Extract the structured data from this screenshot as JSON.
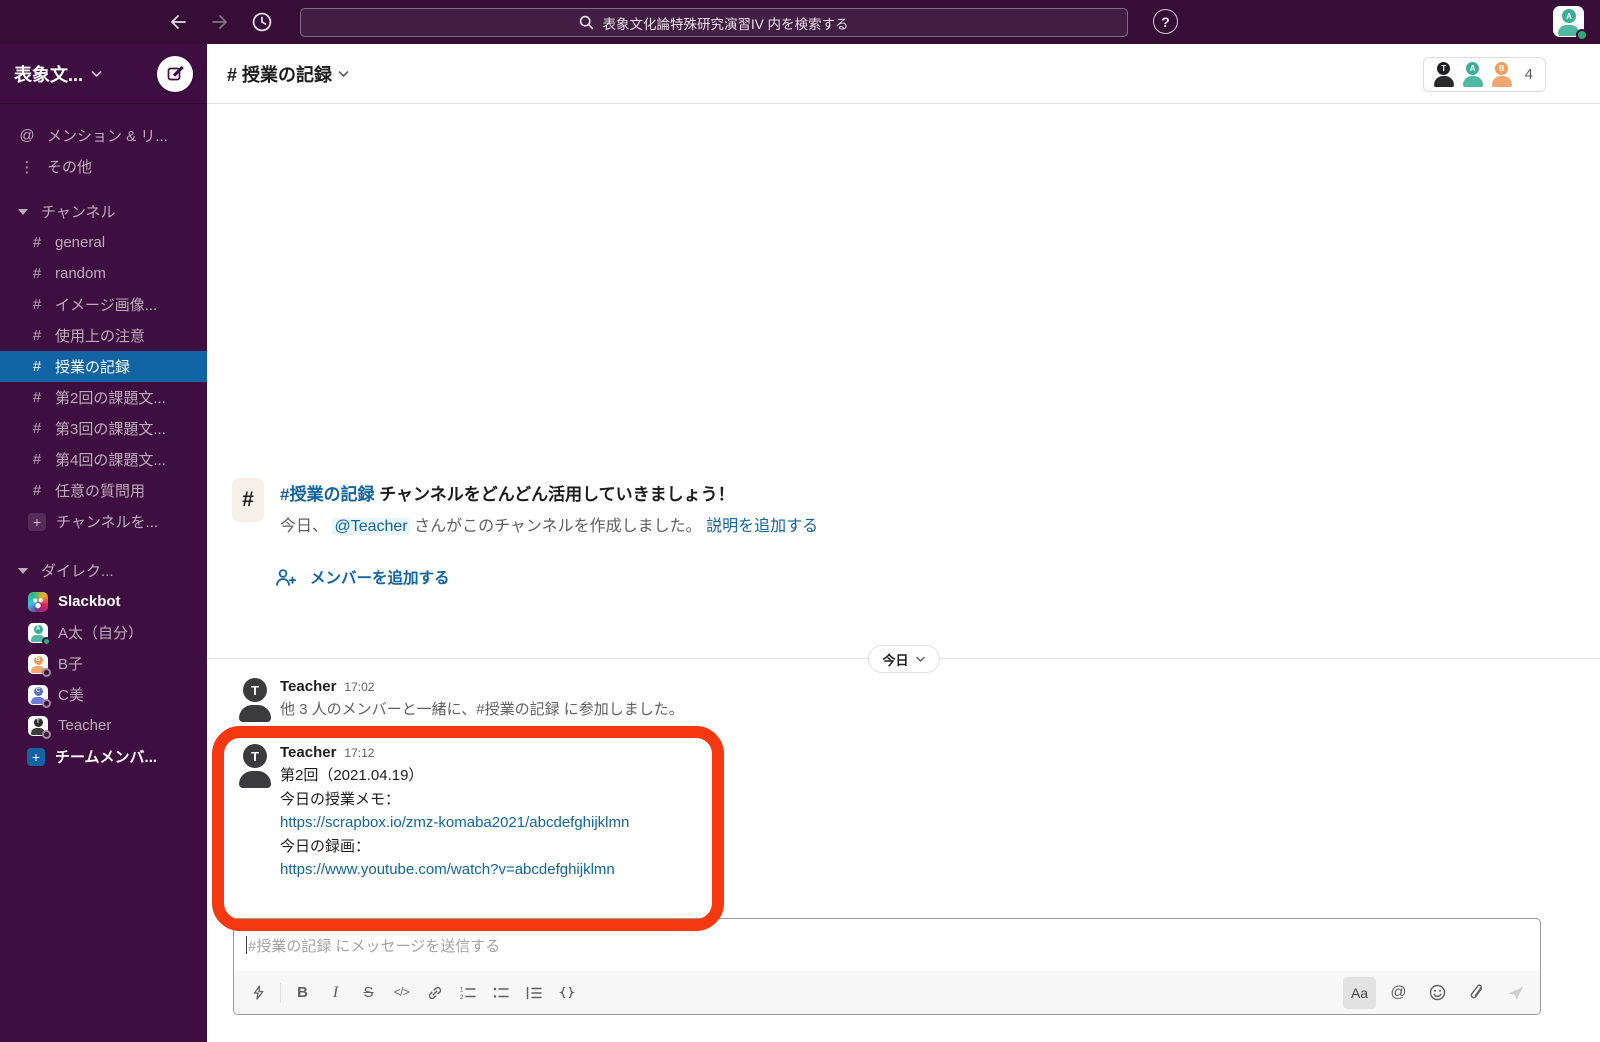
{
  "colors": {
    "topbar_bg": "#350D36",
    "sidebar_bg": "#3F0E40",
    "selected_blue": "#1164A3",
    "link_blue": "#1264A3",
    "annotation_red": "#F5380F",
    "presence_green": "#2BAC76"
  },
  "glyphs": {
    "hash": "#",
    "at": "@",
    "dots": "⋮",
    "plus": "+",
    "question": "?",
    "bold": "B",
    "italic": "I",
    "strike": "S",
    "code": "</>",
    "aa": "Aa"
  },
  "topbar": {
    "search_placeholder": "表象文化論特殊研究演習IV 内を検索する",
    "avatar_initial": "A"
  },
  "sidebar": {
    "workspace_name": "表象文...",
    "nav": [
      {
        "label": "メンション & リ..."
      },
      {
        "label": "その他"
      }
    ],
    "channels_header": "チャンネル",
    "channels": [
      {
        "label": "general"
      },
      {
        "label": "random"
      },
      {
        "label": "イメージ画像..."
      },
      {
        "label": "使用上の注意"
      },
      {
        "label": "授業の記録"
      },
      {
        "label": "第2回の課題文..."
      },
      {
        "label": "第3回の課題文..."
      },
      {
        "label": "第4回の課題文..."
      },
      {
        "label": "任意の質問用"
      }
    ],
    "add_channel_label": "チャンネルを...",
    "dm_header": "ダイレク...",
    "dms": [
      {
        "name": "Slackbot",
        "initial": ""
      },
      {
        "name": "A太（自分）",
        "initial": "A"
      },
      {
        "name": "B子",
        "initial": "B"
      },
      {
        "name": "C美",
        "initial": "C"
      },
      {
        "name": "Teacher",
        "initial": "T"
      }
    ],
    "add_teammates_label": "チームメンバ..."
  },
  "header": {
    "channel_title": "# 授業の記録",
    "member_count": "4",
    "members": [
      {
        "initial": "T"
      },
      {
        "initial": "A"
      },
      {
        "initial": "B"
      }
    ]
  },
  "intro": {
    "channel_link": "#授業の記録",
    "title_rest": "チャンネルをどんどん活用していきましょう！",
    "desc_prefix": "今日、",
    "mention": "@Teacher",
    "desc_middle": "さんがこのチャンネルを作成しました。",
    "desc_link": "説明を追加する",
    "add_member_label": "メンバーを追加する"
  },
  "date_divider": {
    "label": "今日"
  },
  "messages": {
    "first": {
      "author": "Teacher",
      "avatar_initial": "T",
      "time": "17:02",
      "body": "他 3 人のメンバーと一緒に、#授業の記録 に参加しました。"
    },
    "second": {
      "author": "Teacher",
      "avatar_initial": "T",
      "time": "17:12",
      "line1": "第2回（2021.04.19）",
      "line2": "今日の授業メモ：",
      "link1": "https://scrapbox.io/zmz-komaba2021/abcdefghijklmn",
      "line3": "今日の録画：",
      "link2": "https://www.youtube.com/watch?v=abcdefghijklmn"
    }
  },
  "composer": {
    "placeholder": "#授業の記録 にメッセージを送信する"
  }
}
